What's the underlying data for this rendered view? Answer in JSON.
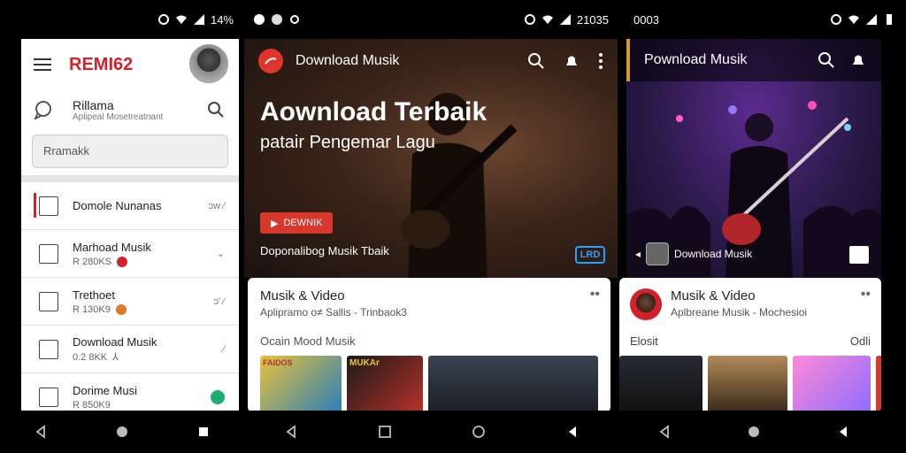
{
  "screen1": {
    "status": {
      "time": "14%"
    },
    "brand": "REMI62",
    "account": {
      "name": "Rillama",
      "sub": "Aplipeal Mosetreatnant"
    },
    "search_placeholder": "Rramakk",
    "items": [
      {
        "title": "Domole Nunanas",
        "meta": "",
        "right": "ɔw ⁄"
      },
      {
        "title": "Marhoad Musik",
        "meta": "R 280KS",
        "right": "⌄"
      },
      {
        "title": "Trethoet",
        "meta": "R 130K9",
        "right": "ɔ' ⁄"
      },
      {
        "title": "Download Musik",
        "meta": "0.2 8KK",
        "right": "⁄"
      },
      {
        "title": "Dorime Musi",
        "meta": "R 850K9",
        "right": ""
      }
    ]
  },
  "screen2": {
    "status": {
      "time": "21035"
    },
    "app_title": "Download Musik",
    "headline": "Aownload Terbaik",
    "subheadline": "patair Pengemar Lagu",
    "button_label": "DEWNIK",
    "caption": "Doponalibog Musik Tbaik",
    "tag": "LRD",
    "card": {
      "title": "Musik & Video",
      "sub": "Aplipramo o≠ Sallis - Trinbaok3",
      "section": "Ocain Mood Musik",
      "thumb_titles": [
        "FAIDOS",
        "MUKAr",
        "",
        ""
      ]
    }
  },
  "screen3": {
    "status": {
      "time": "0003"
    },
    "title": "Pownload Musik",
    "caption": "Download Musik",
    "card": {
      "title": "Musik & Video",
      "sub": "Aplbreane Musik - Mochesioi",
      "section_left": "Elosit",
      "section_right": "Odli"
    }
  },
  "colors": {
    "brand_red": "#d3212c",
    "accent_blue": "#2aa0ff",
    "accent_gold": "#d99a2b"
  }
}
